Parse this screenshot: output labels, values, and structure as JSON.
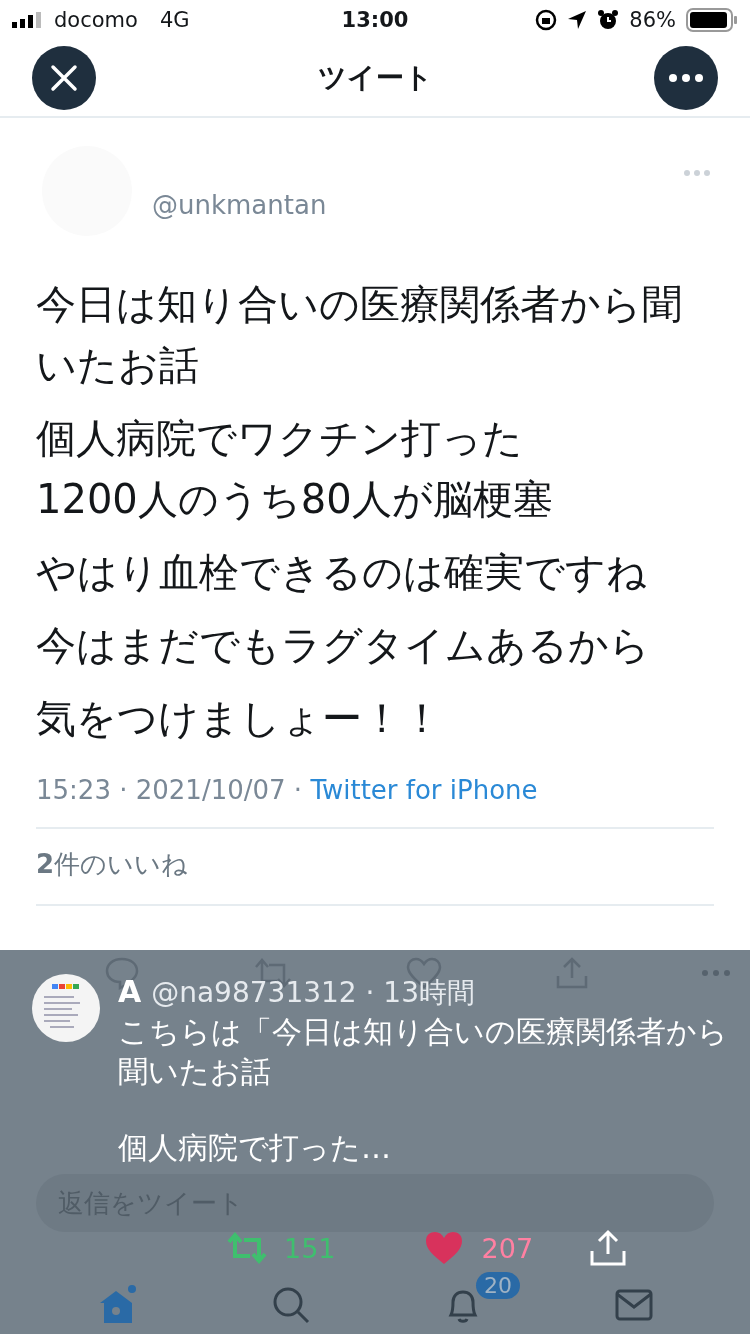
{
  "status_bar": {
    "carrier": "docomo",
    "network": "4G",
    "time": "13:00",
    "battery": "86%"
  },
  "header": {
    "title": "ツイート"
  },
  "tweet": {
    "handle": "@unkmantan",
    "paragraphs": [
      "今日は知り合いの医療関係者から聞いたお話",
      "個人病院でワクチン打った\n1200人のうち80人が脳梗塞",
      "やはり血栓できるのは確実ですね",
      "今はまだでもラグタイムあるから",
      "気をつけましょー！！"
    ],
    "meta": "15:23 · 2021/10/07 · ",
    "source": "Twitter for iPhone",
    "likes": "**2**件のいいね"
  },
  "reply": {
    "name": "A",
    "handle": "@na98731312 · 13時間",
    "paragraphs": [
      "こちらは「今日は知り合いの医療関係者から聞いたお話",
      "個人病院で打った…"
    ],
    "placeholder": "返信をツイート",
    "retweets": "151",
    "likes": "207"
  },
  "tab_bar": {
    "items": [
      {
        "kind": "home",
        "selected": true
      },
      {
        "kind": "search",
        "selected": false
      },
      {
        "kind": "notifications",
        "selected": false,
        "badge": "20"
      },
      {
        "kind": "messages",
        "selected": false
      }
    ]
  }
}
